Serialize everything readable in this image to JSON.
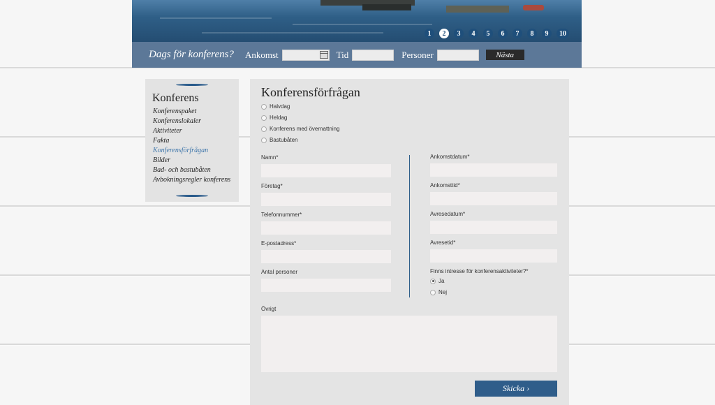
{
  "slides": [
    "1",
    "2",
    "3",
    "4",
    "5",
    "6",
    "7",
    "8",
    "9",
    "10"
  ],
  "active_slide": "2",
  "bookbar": {
    "slogan": "Dags för konferens?",
    "arrival_label": "Ankomst",
    "time_label": "Tid",
    "persons_label": "Personer",
    "next_button": "Nästa"
  },
  "sidebar": {
    "title": "Konferens",
    "items": [
      {
        "label": "Konferenspaket"
      },
      {
        "label": "Konferenslokaler"
      },
      {
        "label": "Aktiviteter"
      },
      {
        "label": "Fakta"
      },
      {
        "label": "Konferensförfrågan"
      },
      {
        "label": "Bilder"
      },
      {
        "label": "Bad- och bastubåten"
      },
      {
        "label": "Avbokningsregler konferens"
      }
    ],
    "active_item": "Konferensförfrågan"
  },
  "form": {
    "title": "Konferensförfrågan",
    "package_options": [
      "Halvdag",
      "Heldag",
      "Konferens med övernattning",
      "Bastubåten"
    ],
    "left_fields": [
      "Namn*",
      "Företag*",
      "Telefonnummer*",
      "E-postadress*",
      "Antal personer"
    ],
    "right_fields": [
      "Ankomstdatum*",
      "Ankomsttid*",
      "Avresedatum*",
      "Avresetid*"
    ],
    "activities_question": "Finns intresse för konferensaktiviteter?*",
    "activities_options": [
      "Ja",
      "Nej"
    ],
    "activities_selected": "Ja",
    "other_label": "Övrigt",
    "submit_label": "Skicka ›"
  },
  "colors": {
    "accent": "#2f5d8a",
    "bookbar": "#5c7898",
    "panel": "#e4e4e4",
    "active_link": "#3c74a9"
  }
}
